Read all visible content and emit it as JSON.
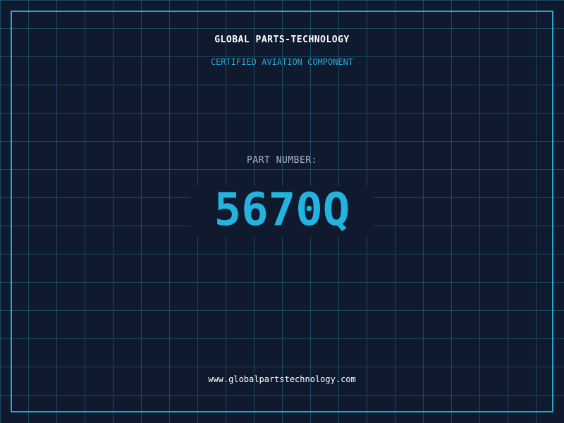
{
  "header": {
    "company": "GLOBAL PARTS-TECHNOLOGY",
    "tagline": "CERTIFIED AVIATION COMPONENT"
  },
  "main": {
    "part_label": "PART NUMBER:",
    "part_number": "5670Q"
  },
  "footer": {
    "website": "www.globalpartstechnology.com"
  },
  "colors": {
    "background": "#101a2e",
    "grid": "#2c809e",
    "frame": "#25a8d4",
    "accent": "#22b3de",
    "label": "#a9b4c6",
    "text": "#ffffff"
  }
}
